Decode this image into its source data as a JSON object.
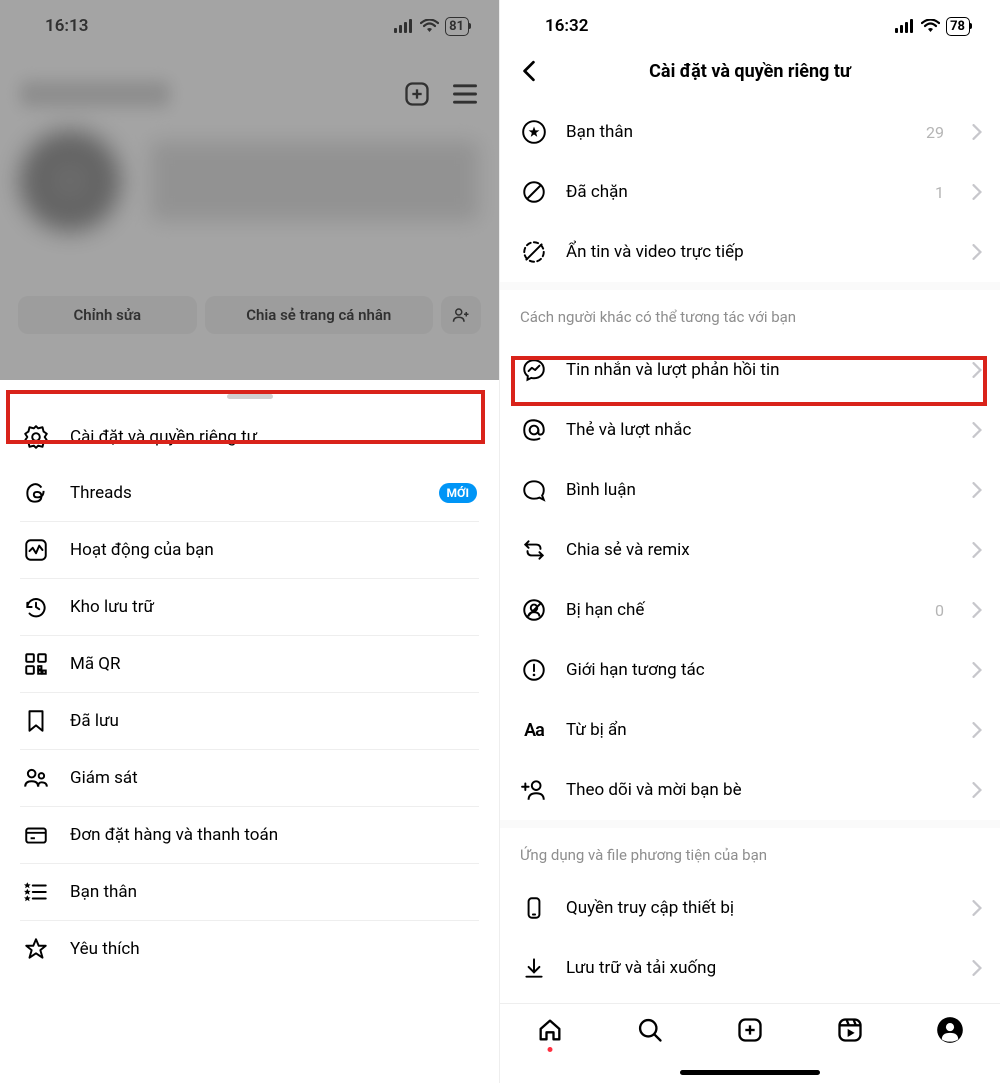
{
  "left": {
    "status": {
      "time": "16:13",
      "battery": "81"
    },
    "profile_buttons": {
      "edit": "Chỉnh sửa",
      "share": "Chia sẻ trang cá nhân"
    },
    "menu": [
      {
        "label": "Cài đặt và quyền riêng tư"
      },
      {
        "label": "Threads",
        "badge": "Mới"
      },
      {
        "label": "Hoạt động của bạn"
      },
      {
        "label": "Kho lưu trữ"
      },
      {
        "label": "Mã QR"
      },
      {
        "label": "Đã lưu"
      },
      {
        "label": "Giám sát"
      },
      {
        "label": "Đơn đặt hàng và thanh toán"
      },
      {
        "label": "Bạn thân"
      },
      {
        "label": "Yêu thích"
      }
    ]
  },
  "right": {
    "status": {
      "time": "16:32",
      "battery": "78"
    },
    "header": "Cài đặt và quyền riêng tư",
    "group1": [
      {
        "label": "Bạn thân",
        "count": "29"
      },
      {
        "label": "Đã chặn",
        "count": "1"
      },
      {
        "label": "Ẩn tin và video trực tiếp"
      }
    ],
    "section2_title": "Cách người khác có thể tương tác với bạn",
    "group2": [
      {
        "label": "Tin nhắn và lượt phản hồi tin"
      },
      {
        "label": "Thẻ và lượt nhắc"
      },
      {
        "label": "Bình luận"
      },
      {
        "label": "Chia sẻ và remix"
      },
      {
        "label": "Bị hạn chế",
        "count": "0"
      },
      {
        "label": "Giới hạn tương tác"
      },
      {
        "label": "Từ bị ẩn"
      },
      {
        "label": "Theo dõi và mời bạn bè"
      }
    ],
    "section3_title": "Ứng dụng và file phương tiện của bạn",
    "group3": [
      {
        "label": "Quyền truy cập thiết bị"
      },
      {
        "label": "Lưu trữ và tải xuống"
      }
    ]
  }
}
